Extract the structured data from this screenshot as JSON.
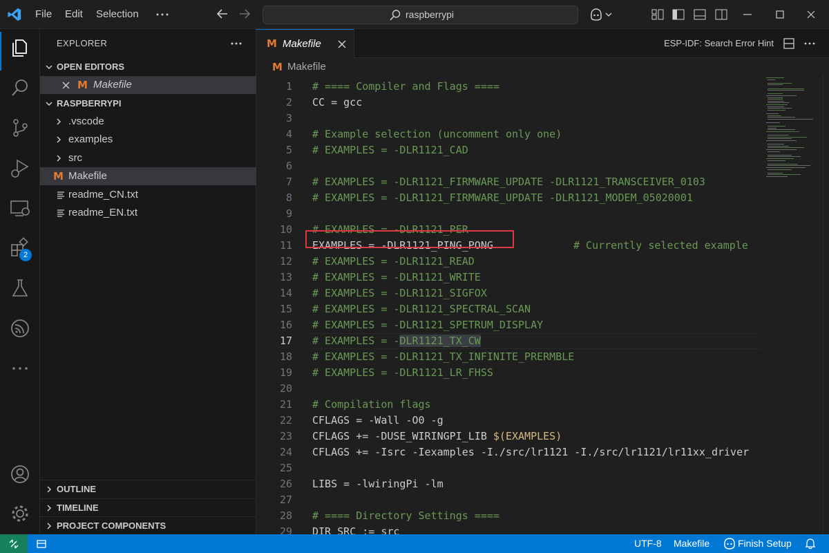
{
  "titlebar": {
    "menu": [
      "File",
      "Edit",
      "Selection"
    ],
    "more": "...",
    "search": "raspberrypi"
  },
  "activity": {
    "extensions_badge": "2"
  },
  "sidebar": {
    "title": "EXPLORER",
    "open_editors_header": "OPEN EDITORS",
    "open_editor_file": "Makefile",
    "project_header": "RASPBERRYPI",
    "tree": [
      {
        "label": ".vscode",
        "type": "folder"
      },
      {
        "label": "examples",
        "type": "folder"
      },
      {
        "label": "src",
        "type": "folder"
      },
      {
        "label": "Makefile",
        "type": "makefile"
      },
      {
        "label": "readme_CN.txt",
        "type": "text"
      },
      {
        "label": "readme_EN.txt",
        "type": "text"
      }
    ],
    "outline": "OUTLINE",
    "timeline": "TIMELINE",
    "project_components": "PROJECT COMPONENTS"
  },
  "editor": {
    "tab_label": "Makefile",
    "hint": "ESP-IDF: Search Error Hint",
    "breadcrumb": "Makefile",
    "current_line": 17,
    "lines": [
      {
        "n": "1",
        "t": "# ==== Compiler and Flags ===="
      },
      {
        "n": "2",
        "t": "CC = gcc"
      },
      {
        "n": "3",
        "t": ""
      },
      {
        "n": "4",
        "t": "# Example selection (uncomment only one)"
      },
      {
        "n": "5",
        "t": "# EXAMPLES = -DLR1121_CAD"
      },
      {
        "n": "6",
        "t": ""
      },
      {
        "n": "7",
        "t": "# EXAMPLES = -DLR1121_FIRMWARE_UPDATE -DLR1121_TRANSCEIVER_0103"
      },
      {
        "n": "8",
        "t": "# EXAMPLES = -DLR1121_FIRMWARE_UPDATE -DLR1121_MODEM_05020001"
      },
      {
        "n": "9",
        "t": ""
      },
      {
        "n": "10",
        "t": "# EXAMPLES = -DLR1121_PER"
      },
      {
        "n": "11",
        "t": "EXAMPLES = -DLR1121_PING_PONG"
      },
      {
        "n": "12",
        "t": "# EXAMPLES = -DLR1121_READ"
      },
      {
        "n": "13",
        "t": "# EXAMPLES = -DLR1121_WRITE"
      },
      {
        "n": "14",
        "t": "# EXAMPLES = -DLR1121_SIGFOX"
      },
      {
        "n": "15",
        "t": "# EXAMPLES = -DLR1121_SPECTRAL_SCAN"
      },
      {
        "n": "16",
        "t": "# EXAMPLES = -DLR1121_SPETRUM_DISPLAY"
      },
      {
        "n": "17",
        "t": "# EXAMPLES = -DLR1121_TX_CW"
      },
      {
        "n": "18",
        "t": "# EXAMPLES = -DLR1121_TX_INFINITE_PRERMBLE"
      },
      {
        "n": "19",
        "t": "# EXAMPLES = -DLR1121_LR_FHSS"
      },
      {
        "n": "20",
        "t": ""
      },
      {
        "n": "21",
        "t": "# Compilation flags"
      },
      {
        "n": "22",
        "t": "CFLAGS = -Wall -O0 -g"
      },
      {
        "n": "23",
        "t": "CFLAGS += -DUSE_WIRINGPI_LIB "
      },
      {
        "n": "24",
        "t": "CFLAGS += -Isrc -Iexamples -I./src/lr1121 -I./src/lr1121/lr11xx_driver"
      },
      {
        "n": "25",
        "t": ""
      },
      {
        "n": "26",
        "t": "LIBS = -lwiringPi -lm"
      },
      {
        "n": "27",
        "t": ""
      },
      {
        "n": "28",
        "t": "# ==== Directory Settings ===="
      },
      {
        "n": "29",
        "t": "DIR_SRC := src"
      }
    ],
    "line11_comment": "# Currently selected example",
    "line23_var": "$(EXAMPLES)",
    "line17_prefix": "# EXAMPLES = -",
    "line17_selected": "DLR1121_TX_CW"
  },
  "statusbar": {
    "encoding": "UTF-8",
    "language": "Makefile",
    "finish_setup": "Finish Setup"
  },
  "colors": {
    "accent": "#0078d4",
    "comment": "#6a9955",
    "makefile_icon": "#e37933",
    "highlight_box": "#e0393e",
    "remote": "#16825d"
  }
}
